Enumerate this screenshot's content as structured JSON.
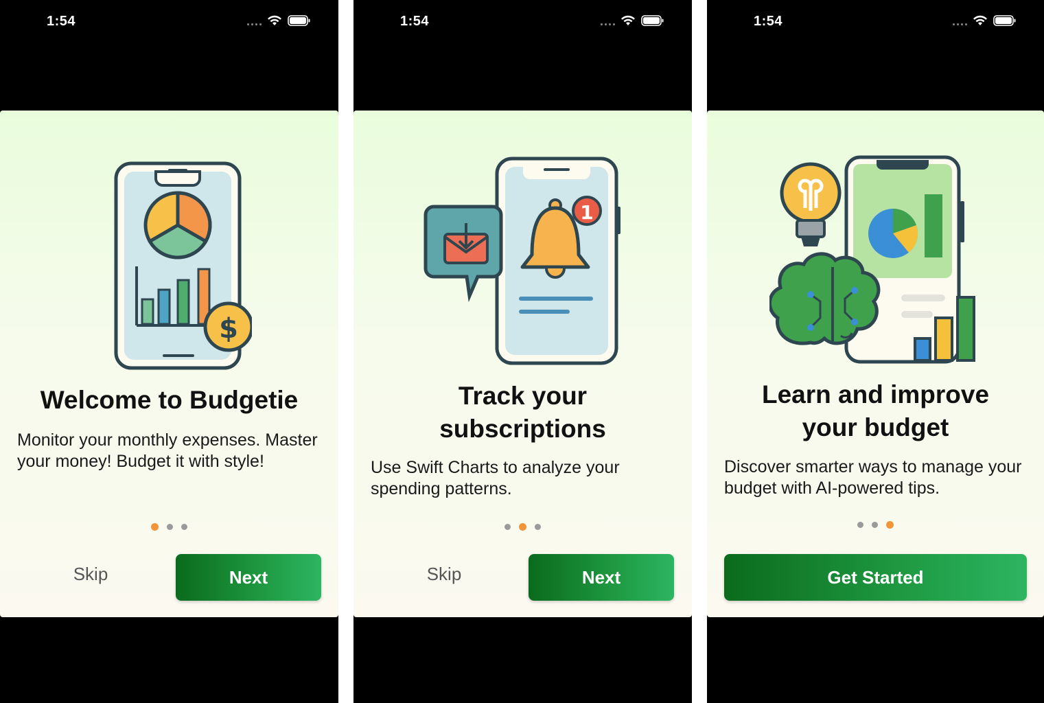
{
  "screens": [
    {
      "time": "1:54",
      "title": "Welcome to Budgetie",
      "description": "Monitor your monthly expenses. Master your money! Budget it with style!",
      "dots": {
        "count": 3,
        "active": 1
      },
      "skip_label": "Skip",
      "primary_label": "Next",
      "illustration": "phone-chart-dollar-icon"
    },
    {
      "time": "1:54",
      "title": "Track your subscriptions",
      "description": "Use Swift Charts to analyze your spending patterns.",
      "dots": {
        "count": 3,
        "active": 2
      },
      "skip_label": "Skip",
      "primary_label": "Next",
      "illustration": "phone-bell-notification-icon",
      "badge_count": "1"
    },
    {
      "time": "1:54",
      "title": "Learn and improve your budget",
      "description": "Discover smarter ways to manage your budget with AI-powered tips.",
      "dots": {
        "count": 3,
        "active": 3
      },
      "primary_label": "Get Started",
      "illustration": "phone-brain-lightbulb-icon"
    }
  ],
  "colors": {
    "accent_green": "#1f9a43",
    "dot_active": "#f0953a",
    "dot_inactive": "#9a9a9a"
  }
}
